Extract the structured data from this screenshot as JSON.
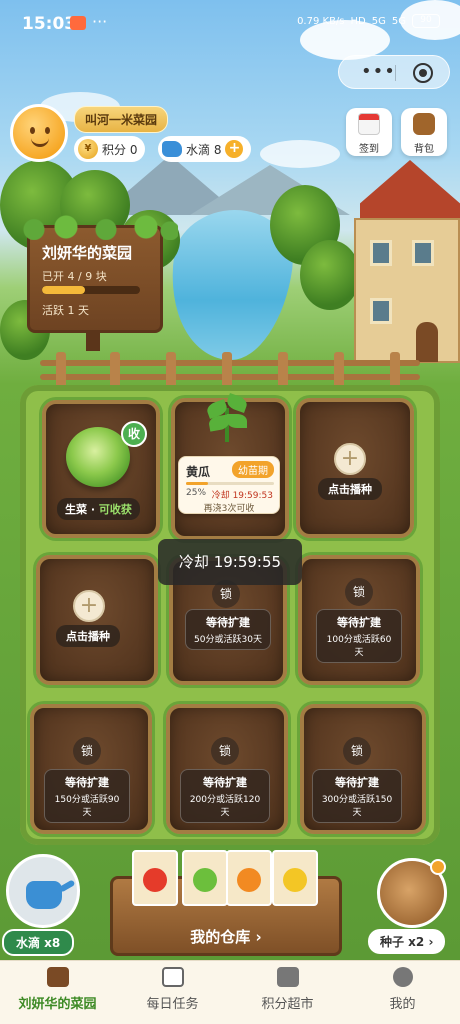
{
  "status_bar": {
    "time": "15:03",
    "net_speed": "0.79 KB/s",
    "hd": "HD",
    "sig1": "5G",
    "sig2": "5G",
    "battery": "90"
  },
  "capsule": {
    "more": "•••"
  },
  "profile": {
    "garden_name_pill": "叫河一米菜园",
    "points_label": "积分 0",
    "water_label": "水滴 8",
    "coin_glyph": "¥",
    "add_glyph": "+"
  },
  "tools": {
    "checkin": "签到",
    "backpack": "背包"
  },
  "sign": {
    "title": "刘妍华的菜园",
    "plots_open": "已开 4 / 9 块",
    "plots_progress": 0.44,
    "active_days": "活跃 1 天"
  },
  "plots": {
    "lettuce": {
      "name": "生菜",
      "sep": "·",
      "status": "可收获",
      "badge": "收"
    },
    "cucumber": {
      "name": "黄瓜",
      "stage": "幼苗期",
      "progress_text": "25%",
      "progress": 0.25,
      "cooldown": "冷却 19:59:53",
      "tip": "再浇3次可收"
    },
    "sow_label": "点击播种",
    "plus_glyph": "+",
    "lock_label": "锁",
    "lock_title": "等待扩建",
    "locked": [
      {
        "req": "50分或活跃30天"
      },
      {
        "req": "100分或活跃60天"
      },
      {
        "req": "150分或活跃90天"
      },
      {
        "req": "200分或活跃120天"
      },
      {
        "req": "300分或活跃150天"
      }
    ]
  },
  "toast": "冷却 19:59:55",
  "warehouse": "我的仓库 ›",
  "water_button": "水滴 x8",
  "seed_button": "种子 x2 ›",
  "tabbar": [
    {
      "label": "刘妍华的菜园"
    },
    {
      "label": "每日任务"
    },
    {
      "label": "积分超市"
    },
    {
      "label": "我的"
    }
  ],
  "colors": {
    "accent_green": "#3d8a25",
    "stage_orange": "#f2a32b",
    "cooldown_red": "#c1351f"
  }
}
